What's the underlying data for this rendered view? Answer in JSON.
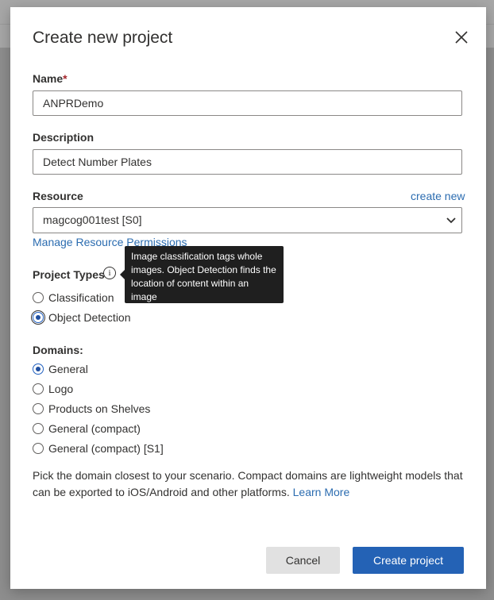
{
  "dialog": {
    "title": "Create new project",
    "close_icon": "close-icon"
  },
  "name": {
    "label": "Name",
    "required_mark": "*",
    "value": "ANPRDemo"
  },
  "description": {
    "label": "Description",
    "value": "Detect Number Plates"
  },
  "resource": {
    "label": "Resource",
    "create_new_link": "create new",
    "selected": "magcog001test [S0]",
    "manage_link": "Manage Resource Permissions"
  },
  "project_types": {
    "label": "Project Types",
    "info_icon": "i",
    "tooltip": "Image classification tags whole images. Object Detection finds the location of content within an image",
    "options": [
      {
        "label": "Classification",
        "checked": false
      },
      {
        "label": "Object Detection",
        "checked": true
      }
    ]
  },
  "domains": {
    "label": "Domains:",
    "options": [
      {
        "label": "General",
        "checked": true
      },
      {
        "label": "Logo",
        "checked": false
      },
      {
        "label": "Products on Shelves",
        "checked": false
      },
      {
        "label": "General (compact)",
        "checked": false
      },
      {
        "label": "General (compact) [S1]",
        "checked": false
      }
    ]
  },
  "help": {
    "text": "Pick the domain closest to your scenario. Compact domains are lightweight models that can be exported to iOS/Android and other platforms.",
    "learn_more": "Learn More"
  },
  "buttons": {
    "cancel": "Cancel",
    "create": "Create project"
  },
  "colors": {
    "accent": "#2462b5",
    "link": "#2b6cb0",
    "tooltip_bg": "#1f1f1f",
    "required": "#a4262c"
  }
}
